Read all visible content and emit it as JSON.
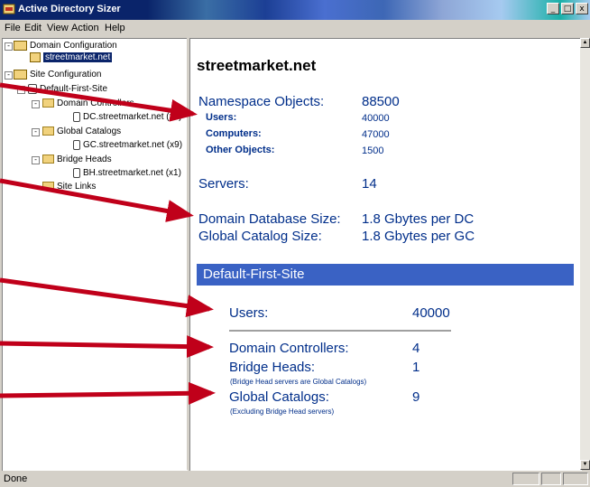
{
  "window": {
    "title": "Active Directory Sizer",
    "minimize_label": "_",
    "maximize_label": "□",
    "close_label": "x"
  },
  "menu": {
    "file": "File",
    "edit": "Edit",
    "view": "View",
    "action": "Action",
    "help": "Help"
  },
  "tree": {
    "domain_config": "Domain Configuration",
    "domain_name": "streetmarket.net",
    "site_config": "Site Configuration",
    "site_name": "Default-First-Site",
    "domain_controllers": "Domain Controllers",
    "dc_server": "DC.streetmarket.net (x4)",
    "global_catalogs": "Global Catalogs",
    "gc_server": "GC.streetmarket.net (x9)",
    "bridge_heads": "Bridge Heads",
    "bh_server": "BH.streetmarket.net (x1)",
    "site_links": "Site Links"
  },
  "main": {
    "domain_heading": "streetmarket.net",
    "namespace_label": "Namespace Objects:",
    "namespace_value": "88500",
    "users_label": "Users:",
    "users_value": "40000",
    "computers_label": "Computers:",
    "computers_value": "47000",
    "other_label": "Other Objects:",
    "other_value": "1500",
    "servers_label": "Servers:",
    "servers_value": "14",
    "db_size_label": "Domain Database Size:",
    "db_size_value": "1.8 Gbytes per DC",
    "gc_size_label": "Global Catalog Size:",
    "gc_size_value": "1.8 Gbytes per GC",
    "site_banner": "Default-First-Site",
    "site_users_label": "Users:",
    "site_users_value": "40000",
    "site_dc_label": "Domain Controllers:",
    "site_dc_value": "4",
    "site_bh_label": "Bridge Heads:",
    "site_bh_value": "1",
    "site_bh_note": "(Bridge Head servers are Global Catalogs)",
    "site_gc_label": "Global Catalogs:",
    "site_gc_value": "9",
    "site_gc_note": "(Excluding Bridge Head servers)"
  },
  "status": {
    "text": "Done"
  },
  "colors": {
    "slide_background": "#000066",
    "arrow": "#c0001a",
    "banner": "#3a62c4",
    "text_blue": "#002e8a"
  }
}
